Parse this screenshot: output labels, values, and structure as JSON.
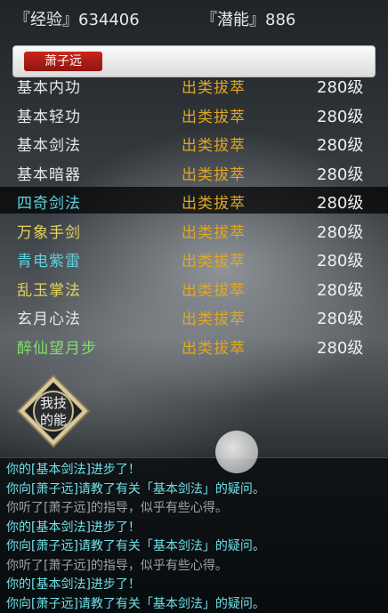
{
  "header": {
    "exp_label": "『经验』634406",
    "pot_label": "『潜能』886"
  },
  "tabs": [
    {
      "label": "萧子远",
      "active": true
    }
  ],
  "skills": [
    {
      "name": "基本内功",
      "grade": "出类拔萃",
      "level": "280级",
      "color": "#e8e8e8",
      "selected": false,
      "partial": true
    },
    {
      "name": "基本轻功",
      "grade": "出类拔萃",
      "level": "280级",
      "color": "#e8e8e8",
      "selected": false
    },
    {
      "name": "基本剑法",
      "grade": "出类拔萃",
      "level": "280级",
      "color": "#e8e8e8",
      "selected": false
    },
    {
      "name": "基本暗器",
      "grade": "出类拔萃",
      "level": "280级",
      "color": "#e8e8e8",
      "selected": false
    },
    {
      "name": "四奇剑法",
      "grade": "出类拔萃",
      "level": "280级",
      "color": "#5fd0e0",
      "selected": true
    },
    {
      "name": "万象手剑",
      "grade": "出类拔萃",
      "level": "280级",
      "color": "#e6d25a",
      "selected": false
    },
    {
      "name": "青电紫雷",
      "grade": "出类拔萃",
      "level": "280级",
      "color": "#5fd0e0",
      "selected": false
    },
    {
      "name": "乱玉掌法",
      "grade": "出类拔萃",
      "level": "280级",
      "color": "#e6d25a",
      "selected": false
    },
    {
      "name": "玄月心法",
      "grade": "出类拔萃",
      "level": "280级",
      "color": "#e8e8e8",
      "selected": false
    },
    {
      "name": "醉仙望月步",
      "grade": "出类拔萃",
      "level": "280级",
      "color": "#7ee06a",
      "selected": false
    }
  ],
  "grade_color": "#e0a820",
  "my_skills_button": {
    "line1": "我技",
    "line2": "的能"
  },
  "log": [
    {
      "text": "你的[基本剑法]进步了！",
      "color": "#6fe0e6"
    },
    {
      "text": "你向[萧子远]请教了有关「基本剑法」的疑问。",
      "color": "#6fe0e6"
    },
    {
      "text": "你听了[萧子远]的指导，似乎有些心得。",
      "color": "#9aa3a6"
    },
    {
      "text": "你的[基本剑法]进步了！",
      "color": "#6fe0e6"
    },
    {
      "text": "你向[萧子远]请教了有关「基本剑法」的疑问。",
      "color": "#6fe0e6"
    },
    {
      "text": "你听了[萧子远]的指导，似乎有些心得。",
      "color": "#9aa3a6"
    },
    {
      "text": "你的[基本剑法]进步了！",
      "color": "#6fe0e6"
    },
    {
      "text": "你向[萧子远]请教了有关「基本剑法」的疑问。",
      "color": "#6fe0e6"
    }
  ]
}
